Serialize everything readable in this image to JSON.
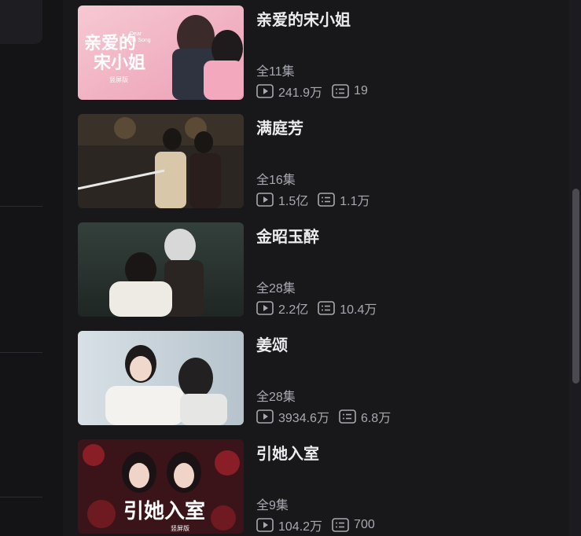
{
  "items": [
    {
      "title": "亲爱的宋小姐",
      "episodes": "全11集",
      "plays": "241.9万",
      "comments": "19",
      "thumb_title_line1": "亲爱的",
      "thumb_title_line2": "宋小姐",
      "thumb_subtitle_en_1": "Dear",
      "thumb_subtitle_en_2": "Miss Song",
      "thumb_badge": "竖屏版",
      "thumb_colors": {
        "bg": "#f2b8c6",
        "accent": "#e85a8c"
      }
    },
    {
      "title": "满庭芳",
      "episodes": "全16集",
      "plays": "1.5亿",
      "comments": "1.1万",
      "thumb_colors": {
        "bg": "#2b2622",
        "accent": "#c9a86a"
      }
    },
    {
      "title": "金昭玉醉",
      "episodes": "全28集",
      "plays": "2.2亿",
      "comments": "10.4万",
      "thumb_colors": {
        "bg": "#2e3633",
        "accent": "#e8e6e0"
      }
    },
    {
      "title": "姜颂",
      "episodes": "全28集",
      "plays": "3934.6万",
      "comments": "6.8万",
      "thumb_colors": {
        "bg": "#c9d4dc",
        "accent": "#f4f2ee"
      }
    },
    {
      "title": "引她入室",
      "episodes": "全9集",
      "plays": "104.2万",
      "comments": "700",
      "thumb_title_line1": "引她入室",
      "thumb_badge": "竖屏版",
      "thumb_colors": {
        "bg": "#3a1418",
        "accent": "#c8323c"
      }
    }
  ],
  "icons": {
    "play": "play-icon",
    "comments": "comment-list-icon"
  }
}
